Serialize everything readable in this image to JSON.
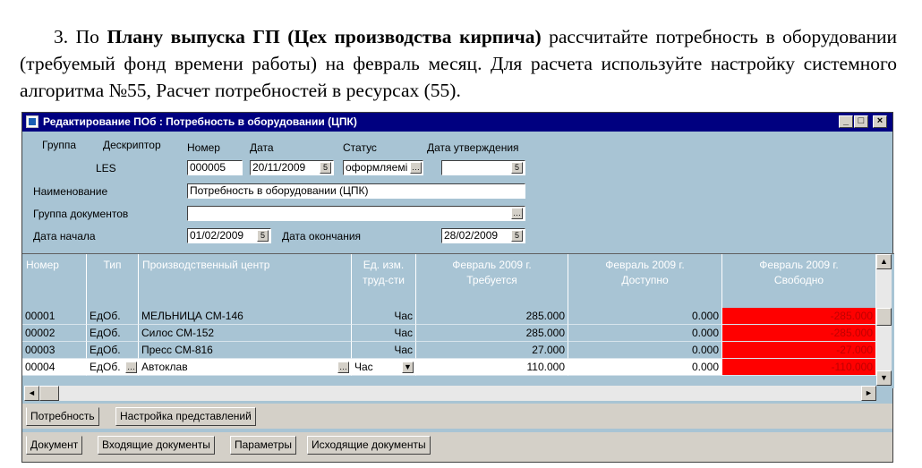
{
  "instruction": {
    "number": "3.",
    "pre": "По",
    "bold": "Плану выпуска ГП (Цех производства кирпича)",
    "post": "рассчитайте потребность в оборудовании (требуемый фонд времени работы) на февраль месяц. Для расчета используйте настройку системного алгоритма №55, Расчет потребностей в ресурсах (55)."
  },
  "window": {
    "title": "Редактирование ПОб : Потребность в оборудовании (ЦПК)",
    "min_label": "_",
    "max_label": "□",
    "close_label": "×"
  },
  "header": {
    "group_label": "Группа",
    "descriptor_label": "Дескриптор",
    "descriptor_value": "LES",
    "number_label": "Номер",
    "number_value": "000005",
    "date_label": "Дата",
    "date_value": "20/11/2009",
    "status_label": "Статус",
    "status_value": "оформляемі",
    "approval_label": "Дата утверждения",
    "approval_value": "",
    "name_label": "Наименование",
    "name_value": "Потребность в оборудовании (ЦПК)",
    "docgroup_label": "Группа документов",
    "docgroup_value": "",
    "start_label": "Дата начала",
    "start_value": "01/02/2009",
    "end_label": "Дата окончания",
    "end_value": "28/02/2009"
  },
  "table": {
    "columns": [
      "Номер",
      "Тип",
      "Производственный центр",
      "Ед. изм. труд-сти",
      "Февраль 2009 г. Требуется",
      "Февраль 2009 г. Доступно",
      "Февраль 2009 г. Свободно"
    ],
    "col_lines": [
      [
        "Номер"
      ],
      [
        "Тип"
      ],
      [
        "Производственный центр"
      ],
      [
        "Ед. изм.",
        "труд-сти"
      ],
      [
        "Февраль 2009 г.",
        "Требуется"
      ],
      [
        "Февраль 2009 г.",
        "Доступно"
      ],
      [
        "Февраль 2009 г.",
        "Свободно"
      ]
    ],
    "rows": [
      {
        "num": "00001",
        "type": "ЕдОб.",
        "center": "МЕЛЬНИЦА СМ-146",
        "unit": "Час",
        "required": "285.000",
        "available": "0.000",
        "free": "-285.000"
      },
      {
        "num": "00002",
        "type": "ЕдОб.",
        "center": "Силос СМ-152",
        "unit": "Час",
        "required": "285.000",
        "available": "0.000",
        "free": "-285.000"
      },
      {
        "num": "00003",
        "type": "ЕдОб.",
        "center": "Пресс СМ-816",
        "unit": "Час",
        "required": "27.000",
        "available": "0.000",
        "free": "-27.000"
      },
      {
        "num": "00004",
        "type": "ЕдОб.",
        "center": "Автоклав",
        "unit": "Час",
        "required": "110.000",
        "available": "0.000",
        "free": "-110.000"
      }
    ]
  },
  "tabs_top": [
    "Потребность",
    "Настройка представлений"
  ],
  "tabs_bottom": [
    "Документ",
    "Входящие документы",
    "Параметры",
    "Исходящие документы"
  ],
  "colors": {
    "title_bar": "#000080",
    "window_bg": "#a8c4d4",
    "negative_bg": "#ff0000"
  }
}
